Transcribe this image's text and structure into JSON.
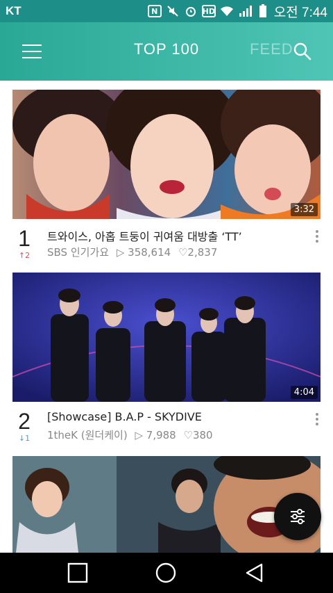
{
  "status_bar": {
    "carrier": "KT",
    "icons": [
      "nfc-icon",
      "mute-icon",
      "alarm-icon",
      "hd-icon",
      "wifi-icon",
      "signal-icon",
      "battery-icon"
    ],
    "hd_label": "HD",
    "time": "오전 7:44"
  },
  "header": {
    "menu_icon": "hamburger-menu-icon",
    "tabs": [
      {
        "label": "TOP 100",
        "active": true
      },
      {
        "label": "FEED",
        "active": false
      }
    ],
    "search_icon": "search-icon"
  },
  "videos": [
    {
      "rank": "1",
      "change": "↑2",
      "change_dir": "up",
      "title": "트와이스, 아홉 트둥이 귀여움 대방출 ‘TT’",
      "channel": "SBS 인기가요",
      "views": "358,614",
      "likes": "2,837",
      "duration": "3:32"
    },
    {
      "rank": "2",
      "change": "↓1",
      "change_dir": "down",
      "title": "[Showcase] B.A.P - SKYDIVE",
      "channel": "1theK (원더케이)",
      "views": "7,988",
      "likes": "380",
      "duration": "4:04"
    }
  ],
  "fab_icon": "filter-sliders-icon",
  "nav": [
    "recents-square-icon",
    "home-circle-icon",
    "back-triangle-icon"
  ],
  "colors": {
    "accent": "#2aa896",
    "rank_up": "#e64b5c",
    "rank_down": "#3ea4d6"
  }
}
